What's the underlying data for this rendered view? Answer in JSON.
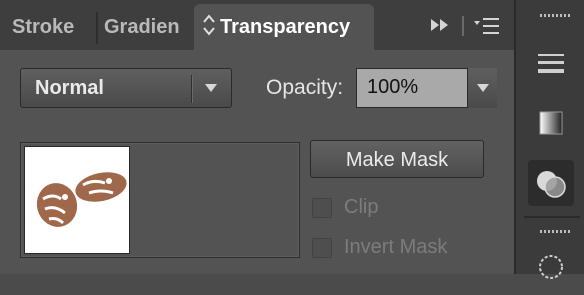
{
  "tabs": [
    {
      "label": "Stroke"
    },
    {
      "label": "Gradien"
    },
    {
      "label": "Transparency",
      "active": true
    }
  ],
  "tab_controls": {
    "collapse_icon": "double-arrow-right-icon",
    "menu_icon": "panel-menu-icon"
  },
  "blend_mode": {
    "value": "Normal"
  },
  "opacity": {
    "label": "Opacity:",
    "value": "100%"
  },
  "make_mask_label": "Make Mask",
  "clip": {
    "label": "Clip",
    "checked": false,
    "enabled": false
  },
  "invert_mask": {
    "label": "Invert Mask",
    "checked": false,
    "enabled": false
  },
  "right_toolbar": {
    "items": [
      "stroke-lines-icon",
      "gradient-icon",
      "transparency-icon",
      "appearance-icon"
    ],
    "active": "transparency-icon"
  },
  "colors": {
    "panel_bg": "#535353",
    "tabbar_bg": "#3e3e3e",
    "artwork_brown": "#a0684a"
  }
}
